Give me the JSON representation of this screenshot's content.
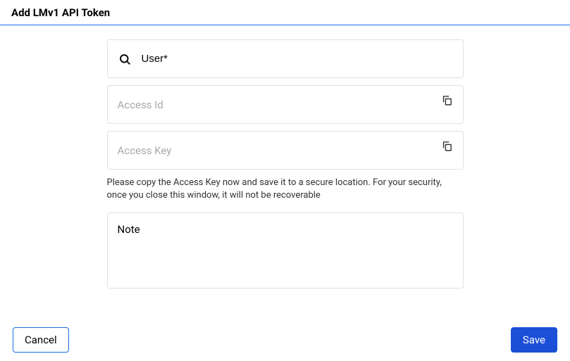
{
  "header": {
    "title": "Add LMv1 API Token"
  },
  "form": {
    "user": {
      "placeholder": "User*",
      "value": ""
    },
    "access_id": {
      "label": "Access Id",
      "value": ""
    },
    "access_key": {
      "label": "Access Key",
      "value": ""
    },
    "helper": "Please copy the Access Key now and save it to a secure location. For your security, once you close this window, it will not be recoverable",
    "note": {
      "placeholder": "Note",
      "value": ""
    }
  },
  "icons": {
    "search": "search-icon",
    "copy": "copy-icon"
  },
  "footer": {
    "cancel": "Cancel",
    "save": "Save"
  }
}
